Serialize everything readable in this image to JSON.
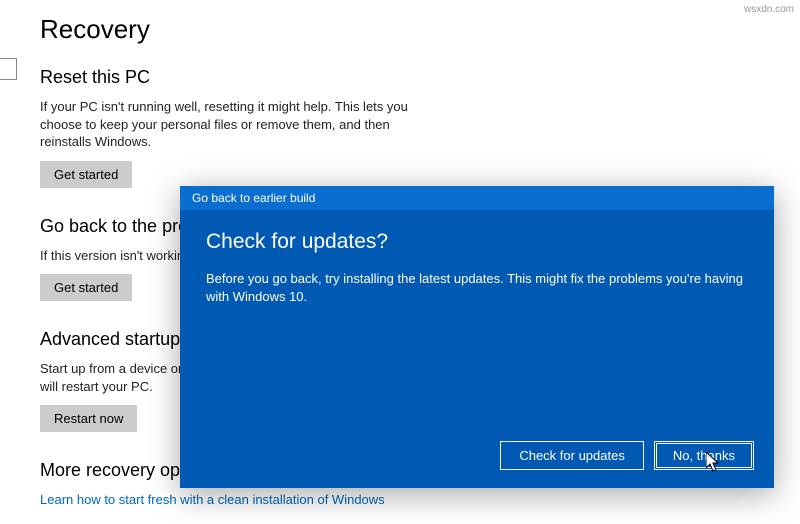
{
  "watermark": "wsxdn.com",
  "page": {
    "title": "Recovery",
    "sections": {
      "reset": {
        "heading": "Reset this PC",
        "body": "If your PC isn't running well, resetting it might help. This lets you choose to keep your personal files or remove them, and then reinstalls Windows.",
        "button": "Get started"
      },
      "goback": {
        "heading": "Go back to the previous",
        "body": "If this version isn't working for",
        "button": "Get started"
      },
      "advanced": {
        "heading": "Advanced startup",
        "body": "Start up from a device or disc (\nWindows startup settings, or re\nThis will restart your PC.",
        "button": "Restart now"
      },
      "more": {
        "heading": "More recovery options",
        "link": "Learn how to start fresh with a clean installation of Windows"
      }
    }
  },
  "dialog": {
    "titlebar": "Go back to earlier build",
    "heading": "Check for updates?",
    "body": "Before you go back, try installing the latest updates. This might fix the problems you're having with Windows 10.",
    "buttons": {
      "check": "Check for updates",
      "no": "No, thanks"
    }
  }
}
